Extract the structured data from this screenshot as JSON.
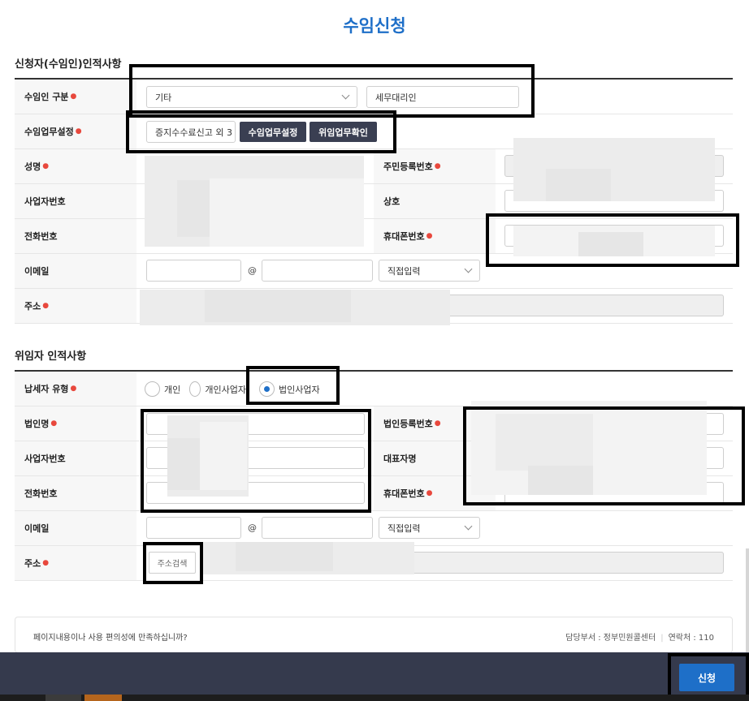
{
  "page": {
    "title": "수임신청"
  },
  "applicant": {
    "section_title": "신청자(수임인)인적사항",
    "type_label": "수임인 구분",
    "type_select": "기타",
    "type_input": "세무대리인",
    "task_label": "수임업무설정",
    "task_input": "증지수수료신고 외 3",
    "task_set_button": "수임업무설정",
    "task_check_button": "위임업무확인",
    "name_label": "성명",
    "rrn_label": "주민등록번호",
    "bizno_label": "사업자번호",
    "company_label": "상호",
    "phone_label": "전화번호",
    "mobile_label": "휴대폰번호",
    "email_label": "이메일",
    "at": "@",
    "email_domain_select": "직접입력",
    "address_label": "주소"
  },
  "delegator": {
    "section_title": "위임자 인적사항",
    "taxpayer_type_label": "납세자 유형",
    "radio_options": [
      "개인",
      "개인사업자",
      "법인사업자"
    ],
    "selected_radio": "법인사업자",
    "corp_name_label": "법인명",
    "corp_regno_label": "법인등록번호",
    "bizno_label": "사업자번호",
    "rep_name_label": "대표자명",
    "phone_label": "전화번호",
    "mobile_label": "휴대폰번호",
    "email_label": "이메일",
    "at": "@",
    "email_domain_select": "직접입력",
    "address_label": "주소",
    "address_search_button": "주소검색"
  },
  "survey": {
    "question": "페이지내용이나 사용 편의성에 만족하십니까?",
    "dept": "담당부서 : 정부민원콜센터",
    "contact": "연락처 : 110"
  },
  "footer": {
    "submit_button": "신청"
  },
  "colors": {
    "accent": "#1e6fc8",
    "dark_button": "#3a3f52",
    "footer": "#353a4d",
    "required": "#e8483d"
  }
}
